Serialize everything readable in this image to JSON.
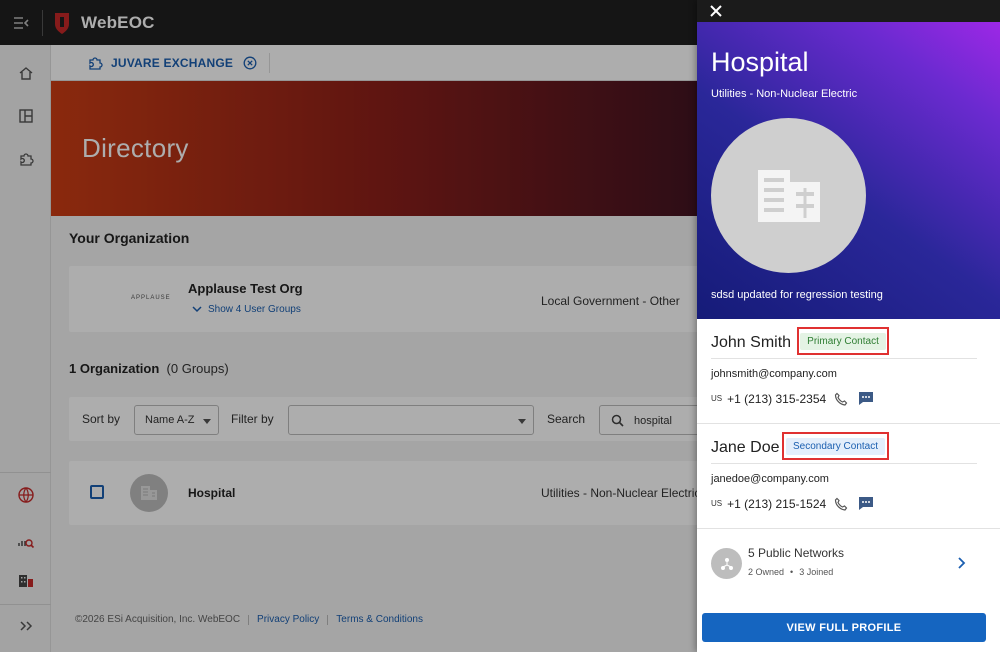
{
  "app": {
    "title": "WebEOC"
  },
  "tab": {
    "label": "JUVARE EXCHANGE"
  },
  "banner": {
    "title": "Directory"
  },
  "your_org": {
    "section_title": "Your Organization",
    "logo_text": "APPLAUSE",
    "name": "Applause Test Org",
    "toggle_label": "Show 4 User Groups",
    "type": "Local Government - Other"
  },
  "results": {
    "count_bold": "1 Organization",
    "count_rest": "(0 Groups)",
    "sort_label": "Sort by",
    "sort_value": "Name A-Z",
    "filter_label": "Filter by",
    "filter_value": "",
    "search_label": "Search",
    "search_value": "hospital",
    "rows": [
      {
        "name": "Hospital",
        "type": "Utilities - Non-Nuclear Electric"
      }
    ]
  },
  "footer": {
    "copyright": "©2026 ESi Acquisition, Inc. WebEOC",
    "privacy": "Privacy Policy",
    "terms": "Terms & Conditions"
  },
  "panel": {
    "title": "Hospital",
    "subtitle": "Utilities - Non-Nuclear Electric",
    "description": "sdsd updated for regression testing",
    "contacts": [
      {
        "name": "John Smith",
        "badge": "Primary Contact",
        "email": "johnsmith@company.com",
        "country": "US",
        "phone": "+1 (213) 315-2354"
      },
      {
        "name": "Jane Doe",
        "badge": "Secondary Contact",
        "email": "janedoe@company.com",
        "country": "US",
        "phone": "+1 (213) 215-1524"
      }
    ],
    "networks": {
      "title": "5 Public Networks",
      "owned": "2 Owned",
      "separator": "•",
      "joined": "3 Joined"
    },
    "view_button": "VIEW FULL PROFILE"
  },
  "colors": {
    "accent": "#1565c0",
    "link": "#1b5fb0",
    "highlight_border": "#e03131",
    "primary_badge": "#2e7d32"
  },
  "icons": [
    "menu-collapse-icon",
    "webeoc-logo-icon",
    "home-icon",
    "dashboard-icon",
    "puzzle-icon",
    "globe-icon",
    "analytics-search-icon",
    "buildings-icon",
    "expand-icon",
    "close-icon",
    "search-icon",
    "building-icon",
    "phone-icon",
    "chat-icon",
    "network-icon",
    "chevron-right-icon",
    "chevron-down-icon"
  ]
}
